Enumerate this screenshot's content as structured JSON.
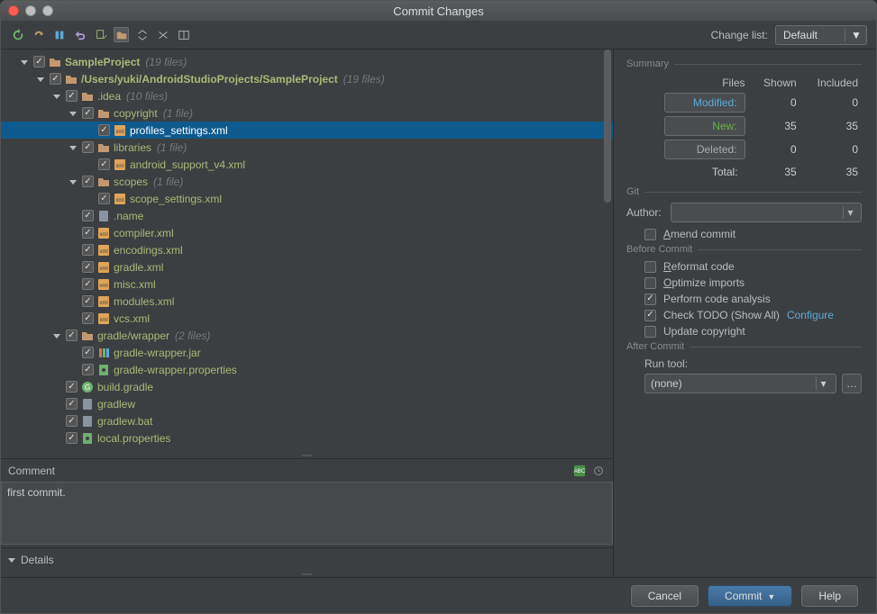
{
  "title": "Commit Changes",
  "toolbar": {
    "change_list_label": "Change list:",
    "change_list_value": "Default"
  },
  "tree": [
    {
      "indent": 0,
      "expand": true,
      "check": true,
      "kind": "root",
      "name": "SampleProject",
      "count": "(19 files)",
      "bold": true
    },
    {
      "indent": 1,
      "expand": true,
      "check": true,
      "kind": "folder",
      "name": "/Users/yuki/AndroidStudioProjects/SampleProject",
      "count": "(19 files)",
      "bold": true
    },
    {
      "indent": 2,
      "expand": true,
      "check": true,
      "kind": "folder",
      "name": ".idea",
      "count": "(10 files)"
    },
    {
      "indent": 3,
      "expand": true,
      "check": true,
      "kind": "folder",
      "name": "copyright",
      "count": "(1 file)"
    },
    {
      "indent": 4,
      "expand": null,
      "check": true,
      "kind": "xml",
      "name": "profiles_settings.xml",
      "selected": true
    },
    {
      "indent": 3,
      "expand": true,
      "check": true,
      "kind": "folder",
      "name": "libraries",
      "count": "(1 file)"
    },
    {
      "indent": 4,
      "expand": null,
      "check": true,
      "kind": "xml",
      "name": "android_support_v4.xml"
    },
    {
      "indent": 3,
      "expand": true,
      "check": true,
      "kind": "folder",
      "name": "scopes",
      "count": "(1 file)"
    },
    {
      "indent": 4,
      "expand": null,
      "check": true,
      "kind": "xml",
      "name": "scope_settings.xml"
    },
    {
      "indent": 3,
      "expand": null,
      "check": true,
      "kind": "file",
      "name": ".name"
    },
    {
      "indent": 3,
      "expand": null,
      "check": true,
      "kind": "xml",
      "name": "compiler.xml"
    },
    {
      "indent": 3,
      "expand": null,
      "check": true,
      "kind": "xml",
      "name": "encodings.xml"
    },
    {
      "indent": 3,
      "expand": null,
      "check": true,
      "kind": "xml",
      "name": "gradle.xml"
    },
    {
      "indent": 3,
      "expand": null,
      "check": true,
      "kind": "xml",
      "name": "misc.xml"
    },
    {
      "indent": 3,
      "expand": null,
      "check": true,
      "kind": "xml",
      "name": "modules.xml"
    },
    {
      "indent": 3,
      "expand": null,
      "check": true,
      "kind": "xml",
      "name": "vcs.xml"
    },
    {
      "indent": 2,
      "expand": true,
      "check": true,
      "kind": "folder",
      "name": "gradle/wrapper",
      "count": "(2 files)"
    },
    {
      "indent": 3,
      "expand": null,
      "check": true,
      "kind": "jar",
      "name": "gradle-wrapper.jar"
    },
    {
      "indent": 3,
      "expand": null,
      "check": true,
      "kind": "prop",
      "name": "gradle-wrapper.properties"
    },
    {
      "indent": 2,
      "expand": null,
      "check": true,
      "kind": "gradle",
      "name": "build.gradle"
    },
    {
      "indent": 2,
      "expand": null,
      "check": true,
      "kind": "file",
      "name": "gradlew"
    },
    {
      "indent": 2,
      "expand": null,
      "check": true,
      "kind": "file",
      "name": "gradlew.bat"
    },
    {
      "indent": 2,
      "expand": null,
      "check": true,
      "kind": "prop",
      "name": "local.properties"
    }
  ],
  "comment": {
    "label": "Comment",
    "value": "first commit."
  },
  "details_label": "Details",
  "summary": {
    "header": "Summary",
    "cols": {
      "files": "Files",
      "shown": "Shown",
      "included": "Included"
    },
    "modified": {
      "label": "Modified:",
      "shown": "0",
      "included": "0"
    },
    "new": {
      "label": "New:",
      "shown": "35",
      "included": "35"
    },
    "deleted": {
      "label": "Deleted:",
      "shown": "0",
      "included": "0"
    },
    "total": {
      "label": "Total:",
      "shown": "35",
      "included": "35"
    }
  },
  "git": {
    "header": "Git",
    "author_label": "Author:",
    "author_value": "",
    "amend_label": "Amend commit"
  },
  "before": {
    "header": "Before Commit",
    "reformat": "Reformat code",
    "optimize": "Optimize imports",
    "analysis": "Perform code analysis",
    "todo": "Check TODO (Show All)",
    "todo_link": "Configure",
    "copyright": "Update copyright"
  },
  "after": {
    "header": "After Commit",
    "run_label": "Run tool:",
    "run_value": "(none)"
  },
  "footer": {
    "cancel": "Cancel",
    "commit": "Commit",
    "help": "Help"
  }
}
